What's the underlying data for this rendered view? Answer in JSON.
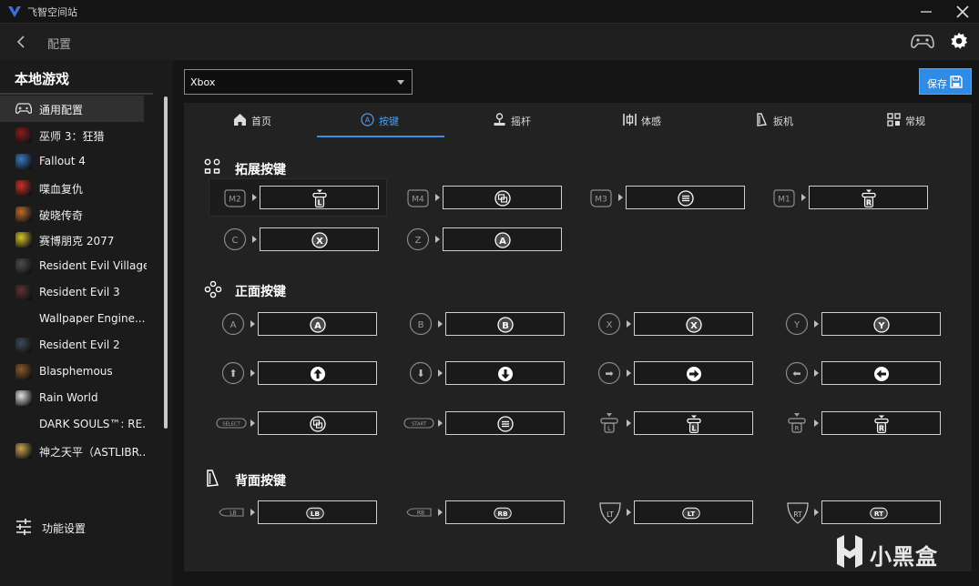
{
  "window": {
    "title": "飞智空间站"
  },
  "header": {
    "title": "配置"
  },
  "sidebar": {
    "title": "本地游戏",
    "games": [
      {
        "label": "通用配置",
        "icon": "gamepad-icon",
        "color": "#303030",
        "active": true
      },
      {
        "label": "巫师 3：狂猎",
        "icon": "witcher-icon",
        "color": "#8a1c1c"
      },
      {
        "label": "Fallout 4",
        "icon": "fallout-icon",
        "color": "#3a78c2"
      },
      {
        "label": "喋血复仇",
        "icon": "back4blood-icon",
        "color": "#c9302c"
      },
      {
        "label": "破晓传奇",
        "icon": "tales-arise-icon",
        "color": "#c06a2a"
      },
      {
        "label": "赛博朋克 2077",
        "icon": "cyberpunk-icon",
        "color": "#d4c52a"
      },
      {
        "label": "Resident Evil Village",
        "icon": "re-village-icon",
        "color": "#4d4d4d"
      },
      {
        "label": "Resident Evil 3",
        "icon": "re3-icon",
        "color": "#5b3232"
      },
      {
        "label": "Wallpaper Engine...",
        "icon": "",
        "color": ""
      },
      {
        "label": "Resident Evil 2",
        "icon": "re2-icon",
        "color": "#3c4a5a"
      },
      {
        "label": "Blasphemous",
        "icon": "blasphemous-icon",
        "color": "#8a5a2a"
      },
      {
        "label": "Rain World",
        "icon": "rain-world-icon",
        "color": "#e0e0e0"
      },
      {
        "label": "DARK SOULS™: RE...",
        "icon": "",
        "color": ""
      },
      {
        "label": "神之天平（ASTLIBR...",
        "icon": "astlibra-icon",
        "color": "#c9a24a"
      }
    ],
    "footer": {
      "label": "功能设置"
    }
  },
  "main": {
    "device_select": {
      "value": "Xbox"
    },
    "save": {
      "label": "保存"
    },
    "tabs": [
      {
        "label": "首页",
        "icon": "home-icon"
      },
      {
        "label": "按键",
        "icon": "button-a-icon",
        "active": true
      },
      {
        "label": "摇杆",
        "icon": "joystick-icon"
      },
      {
        "label": "体感",
        "icon": "motion-icon"
      },
      {
        "label": "扳机",
        "icon": "trigger-icon"
      },
      {
        "label": "常规",
        "icon": "general-icon"
      }
    ],
    "sections": {
      "extended": {
        "title": "拓展按键"
      },
      "face": {
        "title": "正面按键"
      },
      "back": {
        "title": "背面按键"
      }
    },
    "mappings": {
      "m2": {
        "src": "M2",
        "dst": "L"
      },
      "m4": {
        "src": "M4",
        "dst": "view"
      },
      "m3": {
        "src": "M3",
        "dst": "menu"
      },
      "m1": {
        "src": "M1",
        "dst": "R"
      },
      "c": {
        "src": "C",
        "dst": "X"
      },
      "z": {
        "src": "Z",
        "dst": "A"
      },
      "a": {
        "src": "A",
        "dst": "A"
      },
      "b": {
        "src": "B",
        "dst": "B"
      },
      "x": {
        "src": "X",
        "dst": "X"
      },
      "y": {
        "src": "Y",
        "dst": "Y"
      },
      "select": {
        "src": "SELECT",
        "dst": "view"
      },
      "start": {
        "src": "START",
        "dst": "menu"
      },
      "ls": {
        "src": "L",
        "dst": "L"
      },
      "rs": {
        "src": "R",
        "dst": "R"
      },
      "lb": {
        "src": "LB",
        "dst": "LB"
      },
      "rb": {
        "src": "RB",
        "dst": "RB"
      },
      "lt": {
        "src": "LT",
        "dst": "LT"
      },
      "rt": {
        "src": "RT",
        "dst": "RT"
      }
    }
  },
  "watermark": {
    "text": "小黑盒"
  },
  "colors": {
    "accent": "#2f8be6",
    "tab_active": "#4a9eef",
    "bg": "#1b1b1b",
    "panel": "#222222"
  }
}
